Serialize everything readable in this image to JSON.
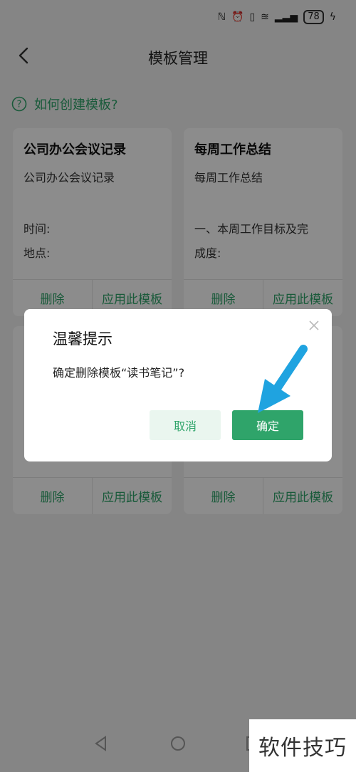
{
  "status_bar": {
    "battery": "78"
  },
  "header": {
    "title": "模板管理"
  },
  "help": {
    "text": "如何创建模板?"
  },
  "cards": [
    {
      "title": "公司办公会议记录",
      "lines": [
        "公司办公会议记录",
        "时间:",
        "地点:"
      ],
      "delete_label": "删除",
      "apply_label": "应用此模板"
    },
    {
      "title": "每周工作总结",
      "lines": [
        "每周工作总结",
        "一、本周工作目标及完",
        "成度:"
      ],
      "delete_label": "删除",
      "apply_label": "应用此模板"
    },
    {
      "delete_label": "删除",
      "apply_label": "应用此模板"
    },
    {
      "delete_label": "删除",
      "apply_label": "应用此模板"
    }
  ],
  "dialog": {
    "title": "温馨提示",
    "message": "确定删除模板“读书笔记”?",
    "cancel_label": "取消",
    "ok_label": "确定"
  },
  "watermark": {
    "text": "软件技巧"
  },
  "colors": {
    "accent": "#2fa46a",
    "arrow": "#1fa3e0"
  }
}
